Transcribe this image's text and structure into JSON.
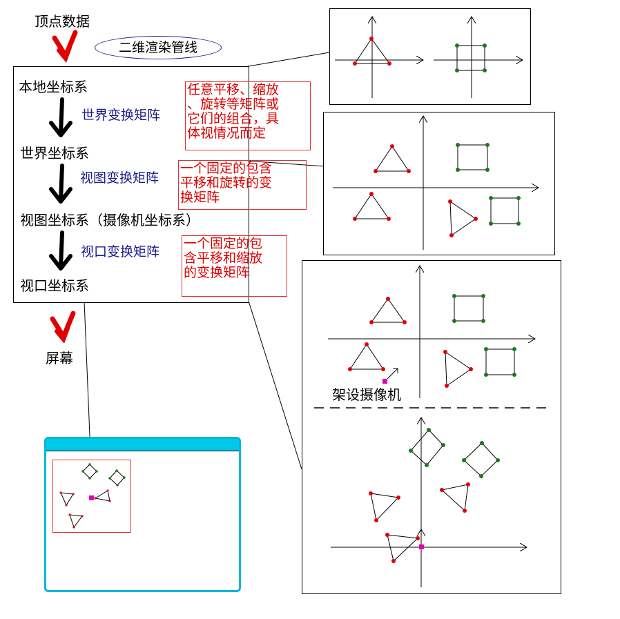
{
  "title": "顶点数据",
  "pipeline_label": "二维渲染管线",
  "stages": {
    "local": "本地坐标系",
    "world_matrix": "世界变换矩阵",
    "world": "世界坐标系",
    "view_matrix": "视图变换矩阵",
    "view": "视图坐标系（摄像机坐标系）",
    "viewport_matrix": "视口变换矩阵",
    "viewport": "视口坐标系"
  },
  "notes": {
    "world_note": "任意平移、缩放\n、旋转等矩阵或\n它们的组合，具\n体视情况而定",
    "view_note": "一个固定的包含\n平移和旋转的变\n换矩阵",
    "viewport_note": "一个固定的包\n含平移和缩放\n的变换矩阵"
  },
  "screen_label": "屏幕",
  "camera_label": "架设摄像机",
  "colors": {
    "arrow_red": "#e00000",
    "arrow_black": "#000000",
    "red_point": "#e00000",
    "green_point": "#1a7a1a",
    "camera": "#e000b0",
    "window_border": "#00b8d8",
    "note_text": "#e00000",
    "matrix_text": "#1a1a8c"
  }
}
